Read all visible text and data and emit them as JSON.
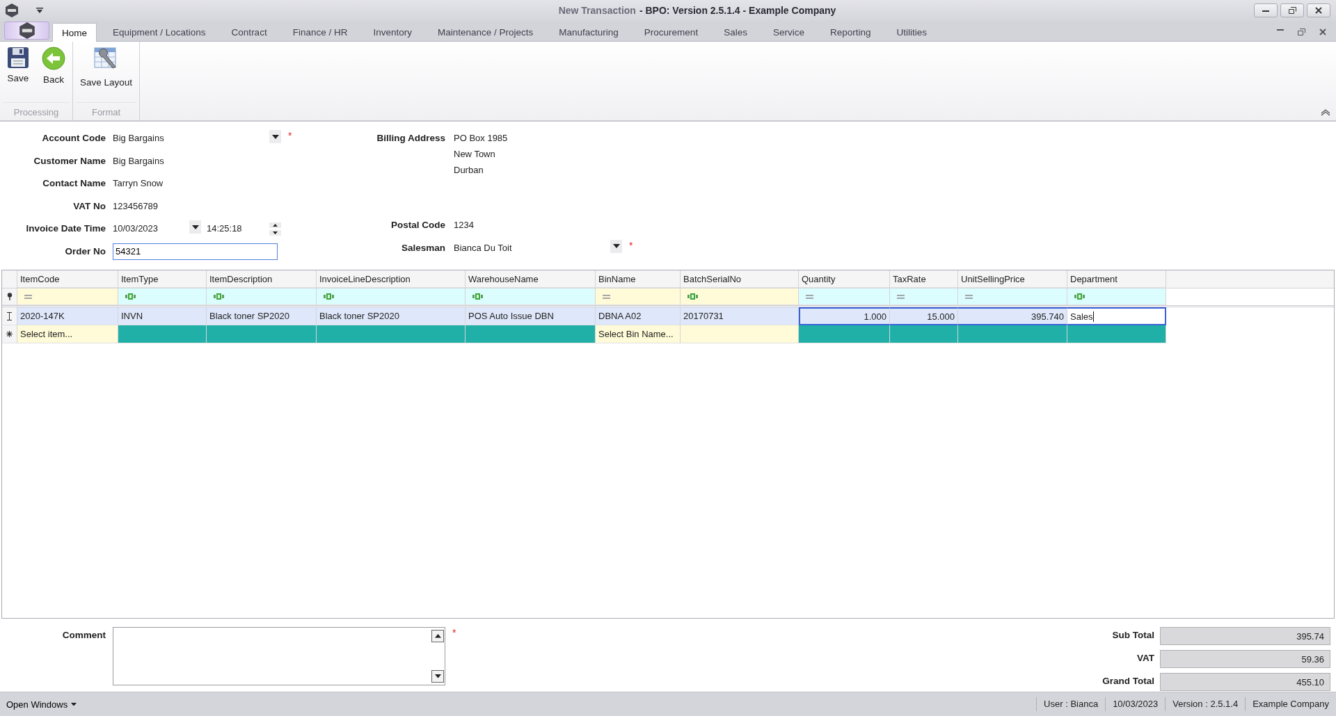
{
  "window": {
    "document": "New Transaction",
    "title": "- BPO: Version 2.5.1.4 - Example Company"
  },
  "ribbon": {
    "tabs": [
      {
        "label": "Home",
        "selected": true
      },
      {
        "label": "Equipment / Locations",
        "selected": false
      },
      {
        "label": "Contract",
        "selected": false
      },
      {
        "label": "Finance / HR",
        "selected": false
      },
      {
        "label": "Inventory",
        "selected": false
      },
      {
        "label": "Maintenance / Projects",
        "selected": false
      },
      {
        "label": "Manufacturing",
        "selected": false
      },
      {
        "label": "Procurement",
        "selected": false
      },
      {
        "label": "Sales",
        "selected": false
      },
      {
        "label": "Service",
        "selected": false
      },
      {
        "label": "Reporting",
        "selected": false
      },
      {
        "label": "Utilities",
        "selected": false
      }
    ],
    "groups": [
      {
        "label": "Processing",
        "buttons": [
          {
            "label": "Save",
            "kind": "save"
          },
          {
            "label": "Back",
            "kind": "back"
          }
        ]
      },
      {
        "label": "Format",
        "buttons": [
          {
            "label": "Save Layout",
            "kind": "layout"
          }
        ]
      }
    ]
  },
  "required_mark": "*",
  "form": {
    "left": [
      {
        "label": "Account Code",
        "kind": "combo",
        "value": "Big Bargains",
        "required": true
      },
      {
        "label": "Customer Name",
        "kind": "text",
        "value": "Big Bargains",
        "required": false
      },
      {
        "label": "Contact Name",
        "kind": "text",
        "value": "Tarryn Snow",
        "required": false
      },
      {
        "label": "VAT No",
        "kind": "text",
        "value": "123456789",
        "required": false
      },
      {
        "label": "Invoice Date Time",
        "kind": "datetime",
        "value": "10/03/2023",
        "time": "14:25:18",
        "required": false
      },
      {
        "label": "Order No",
        "kind": "input",
        "value": "54321",
        "required": false
      }
    ],
    "billing": {
      "label": "Billing Address",
      "lines": [
        "PO Box 1985",
        "New Town",
        "Durban"
      ]
    },
    "right": [
      {
        "label": "Postal Code",
        "kind": "text",
        "value": "1234",
        "required": false
      },
      {
        "label": "Salesman",
        "kind": "combo",
        "value": "Bianca Du Toit",
        "required": true
      }
    ]
  },
  "grid": {
    "columns": [
      {
        "header": "ItemCode",
        "kind": "equals",
        "lookup": true,
        "numeric": false,
        "new_row_text": "Select item..."
      },
      {
        "header": "ItemType",
        "kind": "text",
        "lookup": false,
        "numeric": false
      },
      {
        "header": "ItemDescription",
        "kind": "text",
        "lookup": false,
        "numeric": false
      },
      {
        "header": "InvoiceLineDescription",
        "kind": "text",
        "lookup": false,
        "numeric": false
      },
      {
        "header": "WarehouseName",
        "kind": "text",
        "lookup": false,
        "numeric": false
      },
      {
        "header": "BinName",
        "kind": "equals",
        "lookup": true,
        "numeric": false,
        "new_row_text": "Select Bin Name..."
      },
      {
        "header": "BatchSerialNo",
        "kind": "text",
        "lookup": true,
        "numeric": false
      },
      {
        "header": "Quantity",
        "kind": "equals",
        "lookup": false,
        "numeric": true
      },
      {
        "header": "TaxRate",
        "kind": "equals",
        "lookup": false,
        "numeric": true
      },
      {
        "header": "UnitSellingPrice",
        "kind": "equals",
        "lookup": false,
        "numeric": true
      },
      {
        "header": "Department",
        "kind": "text",
        "lookup": false,
        "numeric": false
      }
    ],
    "rows": [
      {
        "selected": true,
        "cells": [
          {
            "text": "2020-147K",
            "focused": false,
            "editing": false
          },
          {
            "text": "INVN",
            "focused": false,
            "editing": false
          },
          {
            "text": "Black toner SP2020",
            "focused": false,
            "editing": false
          },
          {
            "text": "Black toner SP2020",
            "focused": false,
            "editing": false
          },
          {
            "text": "POS Auto Issue DBN",
            "focused": false,
            "editing": false
          },
          {
            "text": "DBNA A02",
            "focused": false,
            "editing": false
          },
          {
            "text": "20170731",
            "focused": false,
            "editing": false
          },
          {
            "text": "1.000",
            "focused": true,
            "editing": false
          },
          {
            "text": "15.000",
            "focused": true,
            "editing": false
          },
          {
            "text": "395.740",
            "focused": true,
            "editing": false
          },
          {
            "text": "Sales",
            "focused": true,
            "editing": true
          }
        ]
      }
    ]
  },
  "comment": {
    "label": "Comment",
    "required": true
  },
  "totals": [
    {
      "label": "Sub Total",
      "value": "395.74"
    },
    {
      "label": "VAT",
      "value": "59.36"
    },
    {
      "label": "Grand Total",
      "value": "455.10"
    }
  ],
  "status_bar": {
    "menu": "Open Windows",
    "items": [
      "User : Bianca",
      "10/03/2023",
      "Version : 2.5.1.4",
      "Example Company"
    ]
  }
}
